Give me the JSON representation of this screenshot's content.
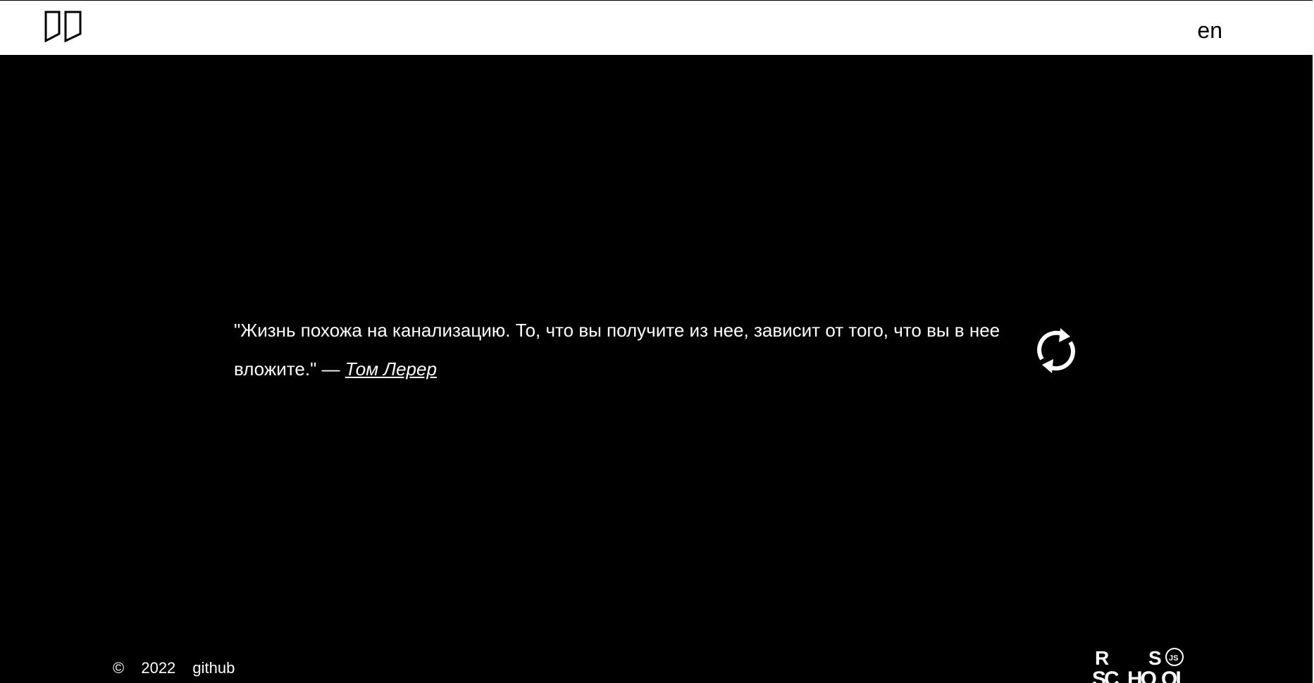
{
  "header": {
    "logo_icon": "quote-marks-icon",
    "lang_label": "en"
  },
  "quote": {
    "text": "\"Жизнь похожа на канализацию. То, что вы получите из нее, зависит от того, что вы в нее вложите.\"",
    "separator": " — ",
    "author": "Том Лерер"
  },
  "refresh_icon": "refresh-icon",
  "footer": {
    "copyright_symbol": "©",
    "year": "2022",
    "github_label": "github",
    "school_logo_lines": [
      "R",
      "S",
      "SC",
      "HO",
      "OL",
      "JS"
    ]
  },
  "colors": {
    "background": "#000000",
    "header_bg": "#ffffff",
    "text": "#ffffff"
  }
}
